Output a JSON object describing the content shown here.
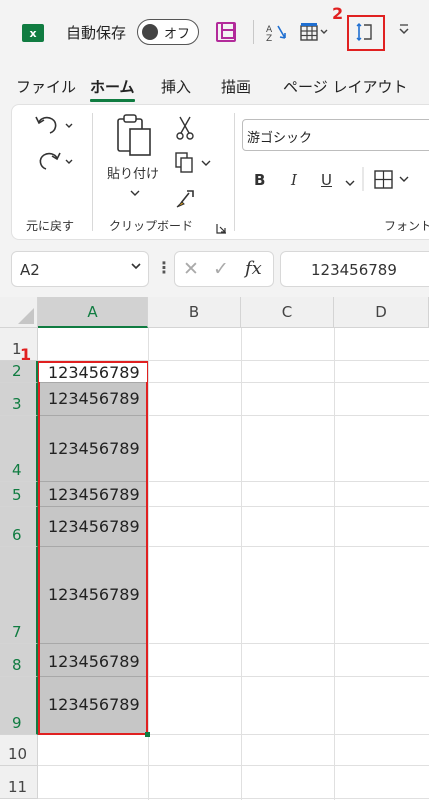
{
  "titlebar": {
    "excel_logo_text": "x",
    "autosave_label": "自動保存",
    "toggle_label": "オフ",
    "badge_2": "2"
  },
  "tabs": [
    "ファイル",
    "ホーム",
    "挿入",
    "描画",
    "ページ レイアウト"
  ],
  "ribbon": {
    "undo_group_label": "元に戻す",
    "paste_label": "貼り付け",
    "clipboard_group_label": "クリップボード",
    "font_name": "游ゴシック",
    "bold": "B",
    "italic": "I",
    "underline": "U",
    "font_group_label": "フォント"
  },
  "formula_bar": {
    "name_box": "A2",
    "fx": "fx",
    "value": "123456789"
  },
  "grid": {
    "columns": [
      "A",
      "B",
      "C",
      "D"
    ],
    "rows": [
      "1",
      "2",
      "3",
      "4",
      "5",
      "6",
      "7",
      "8",
      "9",
      "10",
      "11"
    ],
    "cell_values": [
      "123456789",
      "123456789",
      "123456789",
      "123456789",
      "123456789",
      "123456789",
      "123456789",
      "123456789"
    ],
    "badge_1": "1"
  },
  "colors": {
    "accent": "#107c41",
    "highlight": "#e02020",
    "save_icon": "#b22a9a"
  }
}
